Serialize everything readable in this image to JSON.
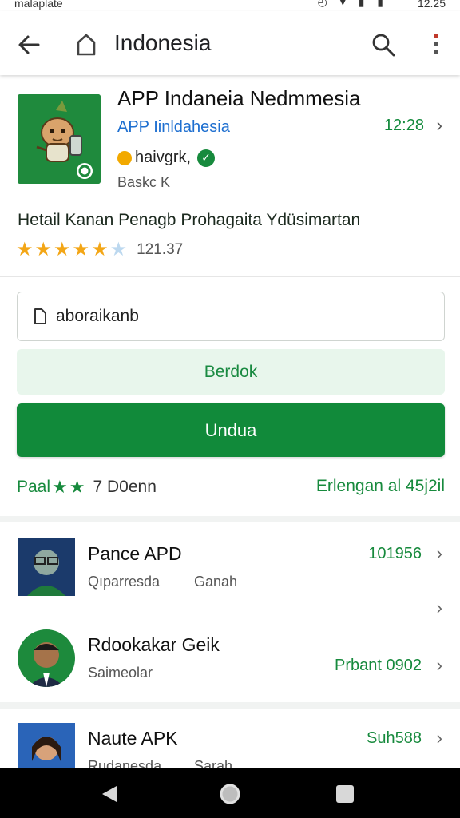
{
  "status_bar": {
    "carrier": "malaplate",
    "time": "12.25",
    "icons": "◴ ▾ ▮ ▮"
  },
  "topbar": {
    "title": "Indonesia"
  },
  "app": {
    "name": "APP Indaneia Nedmmesia",
    "developer": "APP Iinldahesia",
    "version": "12:28",
    "tag": "haivgrk,",
    "category": "Baskc K",
    "description": "Hetail Kanan Penagb Prohagaita Ydüsimartan",
    "rating": 4.5,
    "rating_count": "121.37"
  },
  "form": {
    "input_value": "aboraikanb",
    "secondary_button": "Berdok",
    "primary_button": "Undua"
  },
  "meta": {
    "left_label": "Paal",
    "left_count": "7 D0enn",
    "right_label": "Erlengan al 45j2il"
  },
  "list": [
    {
      "title": "Pance APD",
      "sub": "Qıparresda",
      "sub2": "Ganah",
      "value": "101956"
    },
    {
      "title": "Rdookakar Geik",
      "sub": "Saimeolar",
      "sub2": "",
      "value": "Prbant 0902"
    },
    {
      "title": "Naute APK",
      "sub": "Rudanesda",
      "sub2": "Sarah",
      "value": "Suh588"
    }
  ],
  "colors": {
    "accent": "#118a3a",
    "link": "#1e6fd0",
    "star": "#f3a616"
  }
}
